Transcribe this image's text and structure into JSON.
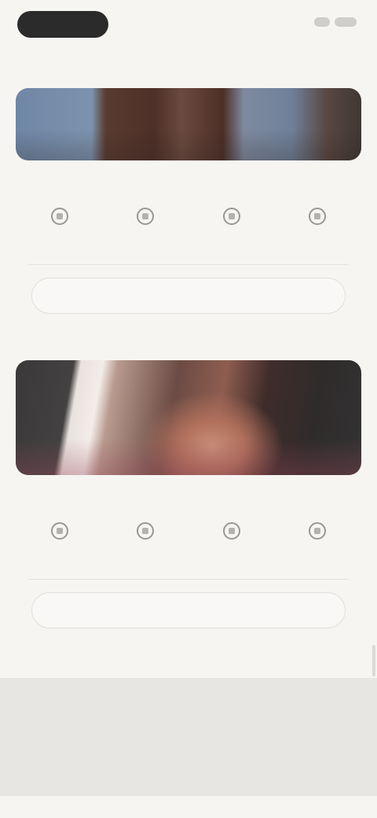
{
  "header": {
    "menu_pill_label": "",
    "menu_pill_icon": "menu-pill",
    "right_icons": [
      "cart-icon",
      "profile-icon"
    ]
  },
  "cards": [
    {
      "title": "",
      "image_icon": "hero-photo",
      "features": [
        {
          "icon": "bed-icon",
          "label": ""
        },
        {
          "icon": "bath-icon",
          "label": ""
        },
        {
          "icon": "guests-icon",
          "label": ""
        },
        {
          "icon": "area-icon",
          "label": ""
        }
      ],
      "cta_label": ""
    },
    {
      "title": "",
      "image_icon": "hero-photo",
      "features": [
        {
          "icon": "bed-icon",
          "label": ""
        },
        {
          "icon": "bath-icon",
          "label": ""
        },
        {
          "icon": "guests-icon",
          "label": ""
        },
        {
          "icon": "area-icon",
          "label": ""
        }
      ],
      "cta_label": ""
    }
  ],
  "footer": {
    "heading": ""
  },
  "colors": {
    "background": "#f6f5f2",
    "pill": "#2b2b2b",
    "promo_band": "#e7e6e2"
  }
}
